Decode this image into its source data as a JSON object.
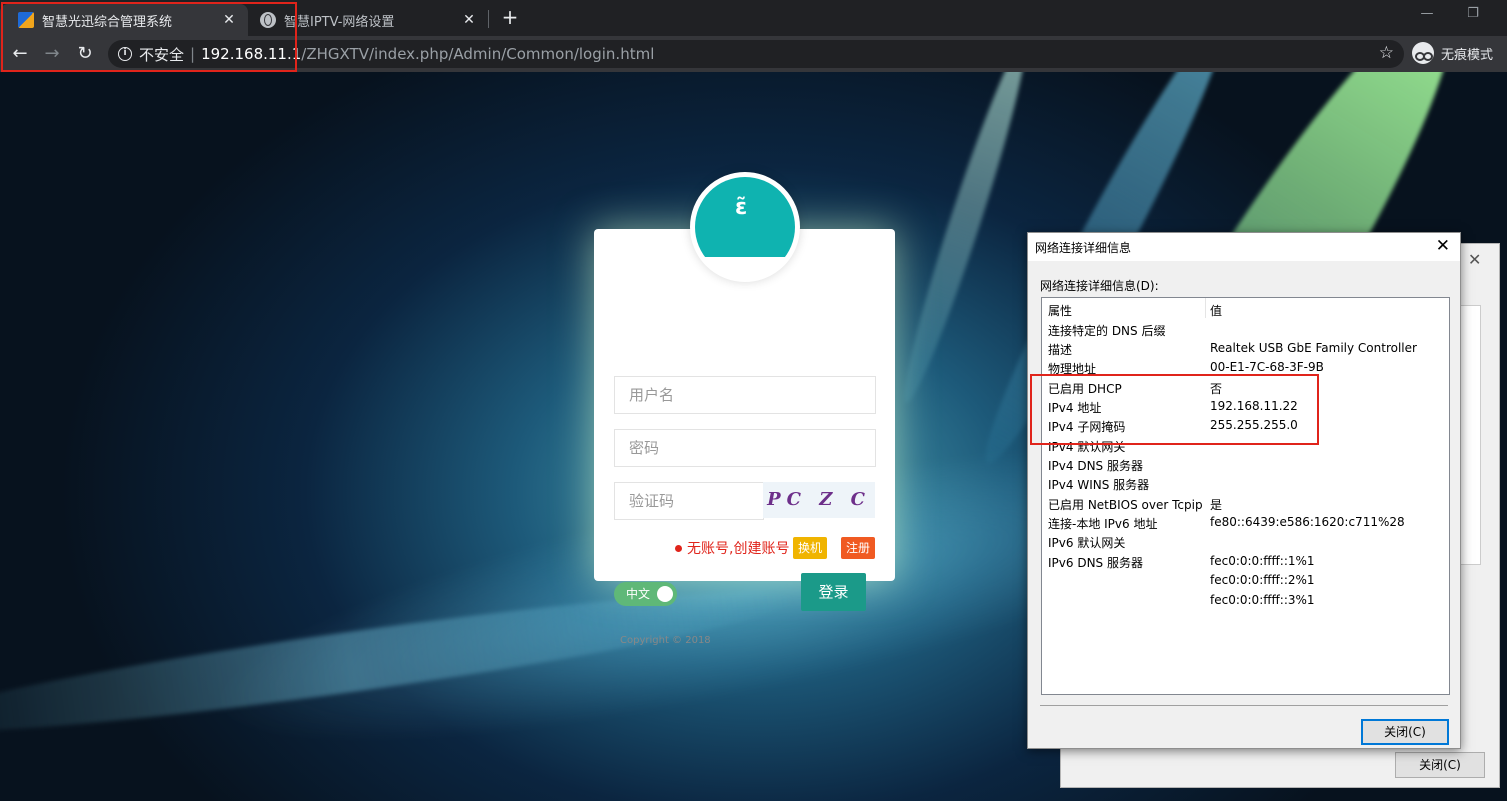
{
  "browser": {
    "tabs": [
      {
        "title": "智慧光迅综合管理系统",
        "close": "✕",
        "active": true
      },
      {
        "title": "智慧IPTV-网络设置",
        "close": "✕",
        "active": false
      }
    ],
    "new_tab": "+",
    "window_controls": [
      "—",
      "❐"
    ],
    "nav": {
      "back": "←",
      "forward": "→",
      "reload": "↻"
    },
    "address": {
      "info": "i",
      "security_text": "不安全",
      "separator": "|",
      "host": "192.168.11.1",
      "path": "/ZHGXTV/index.php/Admin/Common/login.html"
    },
    "bookmark_star": "☆",
    "incognito_label": "无痕模式"
  },
  "login": {
    "avatar_glyph": "ɛ̃",
    "username_placeholder": "用户名",
    "password_placeholder": "密码",
    "captcha_placeholder": "验证码",
    "captcha_text": "PC  Z C",
    "notice": "无账号,创建账号",
    "switch_machine": "换机",
    "register": "注册",
    "language": "中文",
    "login_button": "登录",
    "copyright": "Copyright © 2018"
  },
  "bg_dialog": {
    "close_x": "✕",
    "close_button": "关闭(C)"
  },
  "dialog": {
    "title": "网络连接详细信息",
    "close_x": "✕",
    "label": "网络连接详细信息(D):",
    "header": {
      "property": "属性",
      "value": "值"
    },
    "rows": [
      {
        "property": "连接特定的 DNS 后缀",
        "value": ""
      },
      {
        "property": "描述",
        "value": "Realtek USB GbE Family Controller"
      },
      {
        "property": "物理地址",
        "value": "00-E1-7C-68-3F-9B"
      },
      {
        "property": "已启用 DHCP",
        "value": "否"
      },
      {
        "property": "IPv4 地址",
        "value": "192.168.11.22"
      },
      {
        "property": "IPv4 子网掩码",
        "value": "255.255.255.0"
      },
      {
        "property": "IPv4 默认网关",
        "value": ""
      },
      {
        "property": "IPv4 DNS 服务器",
        "value": ""
      },
      {
        "property": "IPv4 WINS 服务器",
        "value": ""
      },
      {
        "property": "已启用 NetBIOS over Tcpip",
        "value": "是"
      },
      {
        "property": "连接-本地 IPv6 地址",
        "value": "fe80::6439:e586:1620:c711%28"
      },
      {
        "property": "IPv6 默认网关",
        "value": ""
      },
      {
        "property": "IPv6 DNS 服务器",
        "value": "fec0:0:0:ffff::1%1"
      },
      {
        "property": "",
        "value": "fec0:0:0:ffff::2%1"
      },
      {
        "property": "",
        "value": "fec0:0:0:ffff::3%1"
      }
    ],
    "close_button": "关闭(C)"
  },
  "colors": {
    "accent_teal": "#1b9a89",
    "highlight_red": "#e0241b",
    "toggle_green": "#5fb878",
    "switch_yellow": "#f0b400",
    "register_orange": "#f05a22"
  }
}
